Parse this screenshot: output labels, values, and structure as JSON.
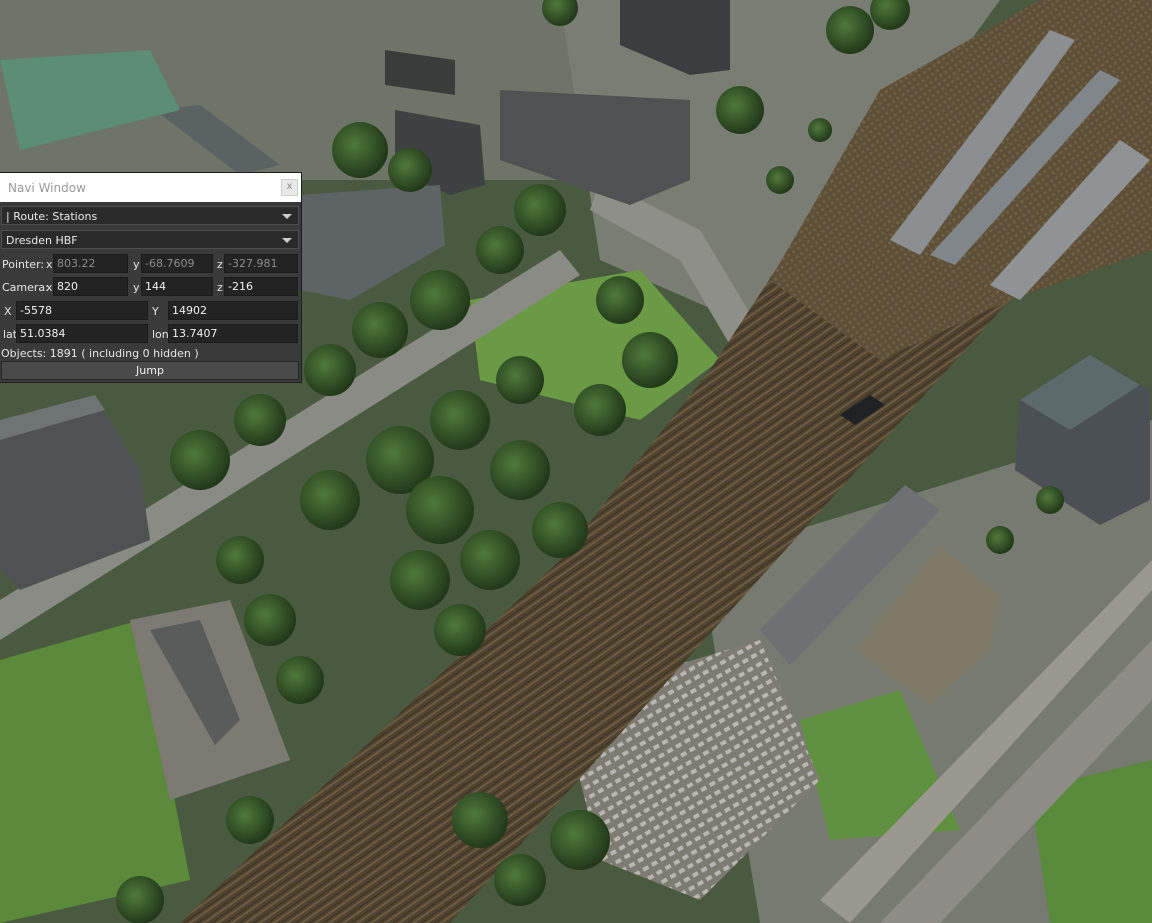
{
  "navi": {
    "title": "Navi Window",
    "close_glyph": "x",
    "route_select": "| Route: Stations",
    "station_select": "Dresden HBF",
    "pointer": {
      "label": "Pointer:",
      "x_label": "x",
      "x": "803.22",
      "y_label": "y",
      "y": "-68.7609",
      "z_label": "z",
      "z": "-327.981"
    },
    "camera": {
      "label": "Camera:",
      "x_label": "x",
      "x": "820",
      "y_label": "y",
      "y": "144",
      "z_label": "z",
      "z": "-216"
    },
    "world": {
      "x_label": "X",
      "x": "-5578",
      "y_label": "Y",
      "y": "14902"
    },
    "geo": {
      "lat_label": "lat",
      "lat": "51.0384",
      "lon_label": "lon",
      "lon": "13.7407"
    },
    "objects": "Objects: 1891 ( including 0 hidden )",
    "jump_label": "Jump"
  },
  "colors": {
    "window_bg": "#3a3a3a",
    "field_bg": "#232323",
    "track_brown": "#4f4330",
    "grass": "#4e7a32",
    "tree": "#2f4f22"
  }
}
